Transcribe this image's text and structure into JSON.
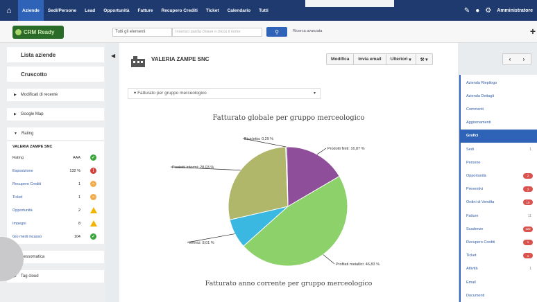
{
  "topnav": {
    "items": [
      "Aziende",
      "Sedi/Persone",
      "Lead",
      "Opportunità",
      "Fatture",
      "Recupero Crediti",
      "Ticket",
      "Calendario",
      "Tutti"
    ],
    "active_index": 0,
    "user": "Amministratore"
  },
  "brand": {
    "logo_text": "CRM Ready",
    "accent": "#2f63b8",
    "nav_bg": "#1f3a6e"
  },
  "search": {
    "scope": "Tutti gli elementi",
    "placeholder": "Inserisci parola chiave o clicca il nome",
    "advanced_link": "Ricerca avanzata"
  },
  "sidebar": {
    "buttons": [
      "Lista aziende",
      "Cruscotto"
    ],
    "sections": [
      "Modificati di recente",
      "Google Map",
      "Rating",
      "Sessomatica",
      "Tag cloud"
    ],
    "rating": {
      "company": "VALERIA ZAMPE SNC",
      "rows": [
        {
          "label": "Rating",
          "value": "AAA",
          "status": "ok"
        },
        {
          "label": "Esposizione",
          "value": "132 %",
          "status": "danger"
        },
        {
          "label": "Recupero Crediti",
          "value": "1",
          "status": "warn"
        },
        {
          "label": "Ticket",
          "value": "1",
          "status": "warn"
        },
        {
          "label": "Opportunità",
          "value": "2",
          "status": "alert"
        },
        {
          "label": "Impegni",
          "value": "8",
          "status": "alert"
        },
        {
          "label": "Gio medi incasso",
          "value": "104",
          "status": "ok"
        }
      ]
    }
  },
  "record": {
    "title": "VALERIA ZAMPE SNC",
    "actions": [
      "Modifica",
      "Invia email",
      "Ulteriori"
    ]
  },
  "filter_select": "Fatturato per gruppo merceologico",
  "chart_data": {
    "type": "pie",
    "title": "Fatturato globale per gruppo merceologico",
    "slices": [
      {
        "name": "Prodotti finiti",
        "value": 16.87,
        "label": "Prodotti finiti: 16,87 %",
        "color": "#8e4e9a"
      },
      {
        "name": "Profilati metallici",
        "value": 46.83,
        "label": "Profilati metallici: 46,83 %",
        "color": "#8cd16a"
      },
      {
        "name": "Vernici",
        "value": 8.01,
        "label": "Vernici: 8,01 %",
        "color": "#3bb8e2"
      },
      {
        "name": "Prodotti intermi",
        "value": 28.0,
        "label": "Prodotti intermi: 28,03 %",
        "color": "#b0b66a"
      },
      {
        "name": "Bicicletta",
        "value": 0.29,
        "label": "Bicicletta: 0,29 %",
        "color": "#6a5acd"
      }
    ],
    "subtitle_next": "Fatturato anno corrente per gruppo merceologico"
  },
  "rightnav": {
    "items": [
      {
        "label": "Azienda Riepilogo"
      },
      {
        "label": "Azienda Dettagli"
      },
      {
        "label": "Commenti"
      },
      {
        "label": "Aggiornamenti"
      },
      {
        "label": "Grafici",
        "active": true
      },
      {
        "label": "Sedi",
        "count": "1"
      },
      {
        "label": "Persone"
      },
      {
        "label": "Opportunità",
        "pill": "2"
      },
      {
        "label": "Preventivi",
        "pill": "2"
      },
      {
        "label": "Ordini di Vendita",
        "pill": "10"
      },
      {
        "label": "Fatture",
        "count": "11"
      },
      {
        "label": "Scadenze",
        "pill": "122"
      },
      {
        "label": "Recupero Crediti",
        "pill": "1"
      },
      {
        "label": "Ticket",
        "pill": "1"
      },
      {
        "label": "Attività",
        "count": "1"
      },
      {
        "label": "Email"
      },
      {
        "label": "Documenti"
      }
    ]
  }
}
